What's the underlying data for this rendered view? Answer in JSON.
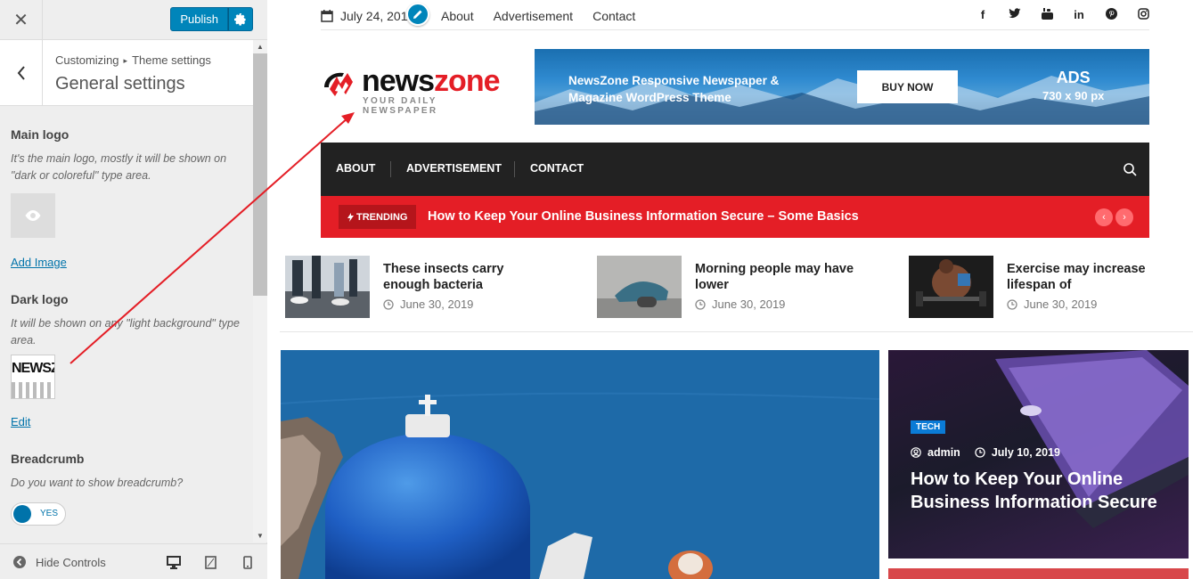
{
  "customizer": {
    "close_label": "✕",
    "publish_label": "Publish",
    "breadcrumb": {
      "parent": "Customizing",
      "separator": "▸",
      "current": "Theme settings"
    },
    "section_title": "General settings",
    "main_logo": {
      "title": "Main logo",
      "description": "It's the main logo, mostly it will be shown on \"dark or coloreful\" type area.",
      "action": "Add Image"
    },
    "dark_logo": {
      "title": "Dark logo",
      "description": "It will be shown on any \"light background\" type area.",
      "thumb_text": "NEWSZON",
      "action": "Edit"
    },
    "breadcrumb_ctl": {
      "title": "Breadcrumb",
      "description": "Do you want to show breadcrumb?",
      "toggle": "YES"
    },
    "footer": {
      "hide_controls": "Hide Controls"
    }
  },
  "preview": {
    "topbar": {
      "date": "July 24, 201",
      "nav": [
        "About",
        "Advertisement",
        "Contact"
      ],
      "socials": [
        "f",
        "t",
        "yt",
        "in",
        "p",
        "ig"
      ]
    },
    "logo": {
      "news": "news",
      "zone": "zone",
      "tagline": "YOUR DAILY NEWSPAPER"
    },
    "ad": {
      "text_line1": "NewsZone Responsive Newspaper &",
      "text_line2": "Magazine WordPress Theme",
      "button": "BUY NOW",
      "label1": "ADS",
      "label2": "730 x 90 px"
    },
    "mainnav": [
      "ABOUT",
      "ADVERTISEMENT",
      "CONTACT"
    ],
    "trending": {
      "badge": "TRENDING",
      "headline": "How to Keep Your Online Business Information Secure – Some Basics"
    },
    "mini_posts": [
      {
        "title": "These insects carry enough bacteria",
        "date": "June 30, 2019"
      },
      {
        "title": "Morning people may have lower",
        "date": "June 30, 2019"
      },
      {
        "title": "Exercise may increase lifespan of",
        "date": "June 30, 2019"
      }
    ],
    "feature": {
      "category": "TECH",
      "author": "admin",
      "date": "July 10, 2019",
      "title": "How to Keep Your Online Business Information Secure"
    }
  },
  "colors": {
    "brand_red": "#e41e26",
    "wp_blue": "#0085ba",
    "nav_dark": "#222222",
    "link_blue": "#0073aa"
  }
}
